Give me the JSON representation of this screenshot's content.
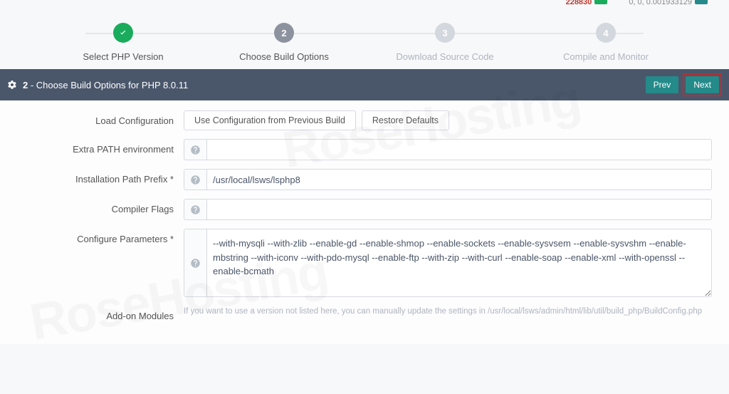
{
  "top": {
    "stat_left": "228830",
    "stat_right": "0, 0, 0.001933129"
  },
  "wizard": {
    "steps": [
      {
        "num": "",
        "label": "Select PHP Version",
        "state": "done"
      },
      {
        "num": "2",
        "label": "Choose Build Options",
        "state": "current"
      },
      {
        "num": "3",
        "label": "Download Source Code",
        "state": "upcoming"
      },
      {
        "num": "4",
        "label": "Compile and Monitor",
        "state": "upcoming"
      }
    ]
  },
  "header": {
    "step_num": "2",
    "title": "Choose Build Options for PHP 8.0.11",
    "prev": "Prev",
    "next": "Next"
  },
  "form": {
    "load_cfg_label": "Load Configuration",
    "btn_prev_build": "Use Configuration from Previous Build",
    "btn_restore": "Restore Defaults",
    "extra_path_label": "Extra PATH environment",
    "extra_path_value": "",
    "install_prefix_label": "Installation Path Prefix *",
    "install_prefix_value": "/usr/local/lsws/lsphp8",
    "compiler_label": "Compiler Flags",
    "compiler_value": "",
    "configure_label": "Configure Parameters *",
    "configure_value": "--with-mysqli --with-zlib --enable-gd --enable-shmop --enable-sockets --enable-sysvsem --enable-sysvshm --enable-mbstring --with-iconv --with-pdo-mysql --enable-ftp --with-zip --with-curl --enable-soap --enable-xml --with-openssl --enable-bcmath",
    "addon_label": "Add-on Modules",
    "addon_hint": "If you want to use a version not listed here, you can manually update the settings in /usr/local/lsws/admin/html/lib/util/build_php/BuildConfig.php"
  }
}
